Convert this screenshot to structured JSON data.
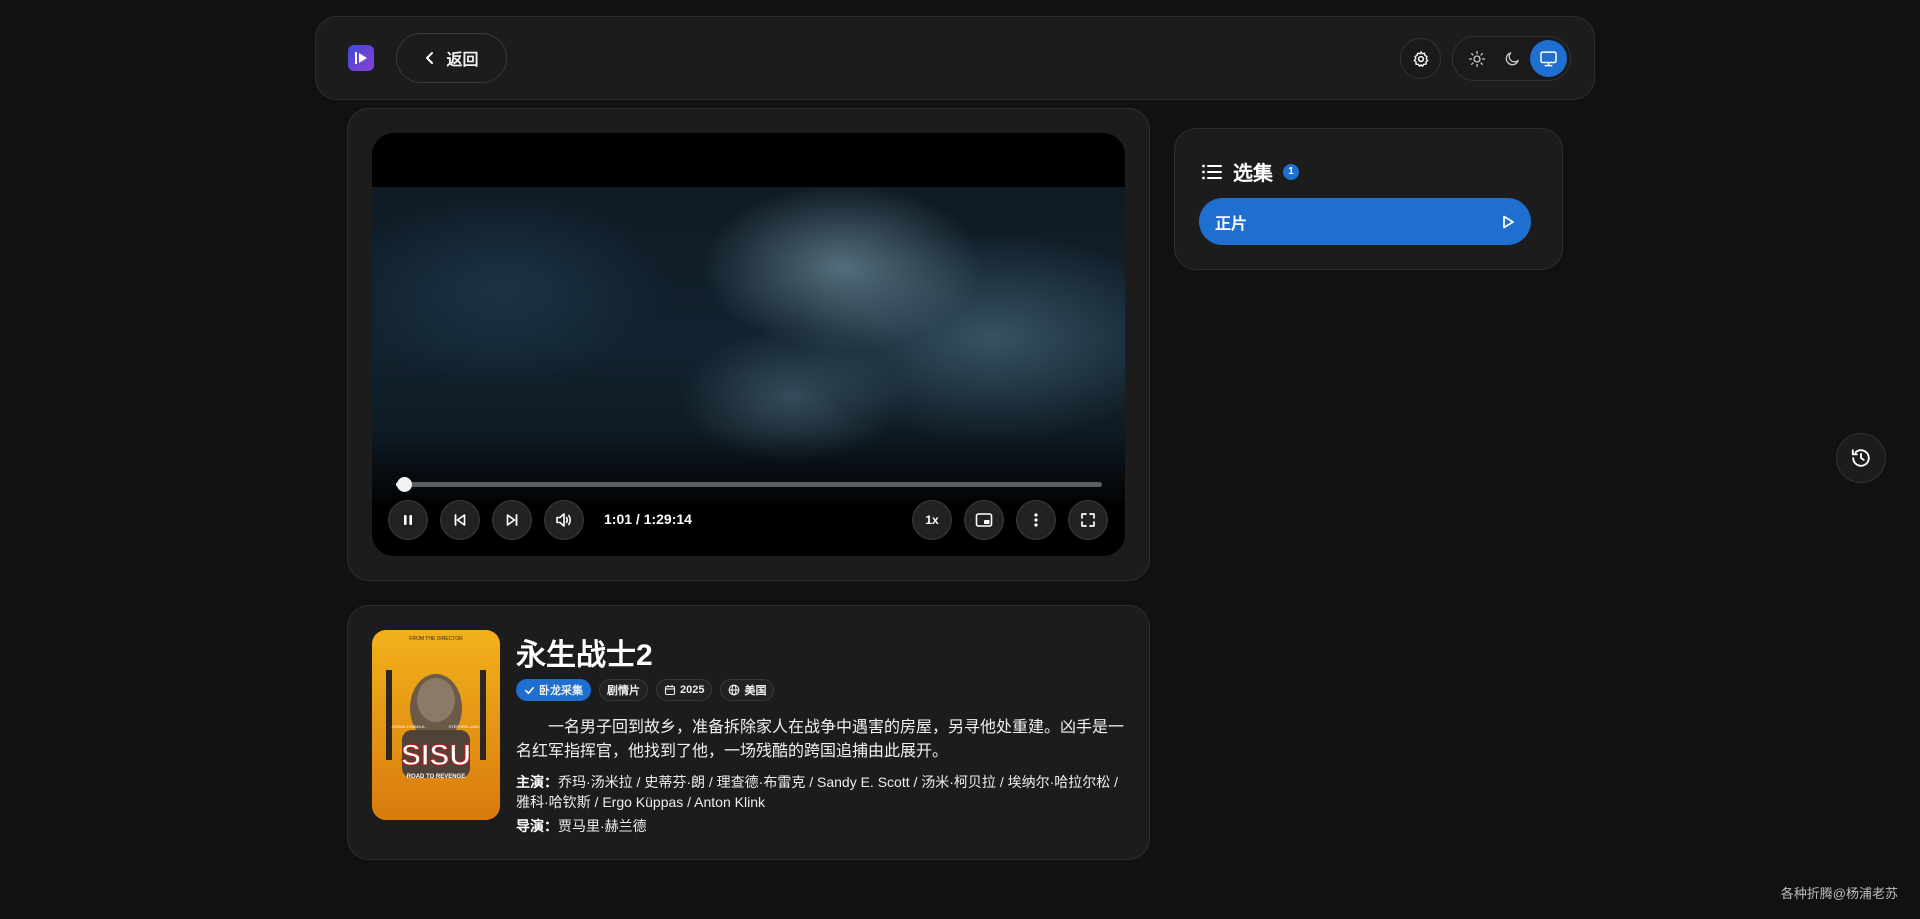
{
  "header": {
    "back_label": "返回"
  },
  "player": {
    "time_display": "1:01 / 1:29:14",
    "speed_label": "1x",
    "progress": 0.0114
  },
  "episodes": {
    "title": "选集",
    "count": "1",
    "items": [
      {
        "label": "正片"
      }
    ]
  },
  "movie": {
    "title": "永生战士2",
    "tags": {
      "source": "卧龙采集",
      "genre": "剧情片",
      "year": "2025",
      "region": "美国"
    },
    "synopsis": "一名男子回到故乡，准备拆除家人在战争中遇害的房屋，另寻他处重建。凶手是一名红军指挥官，他找到了他，一场残酷的跨国追捕由此展开。",
    "cast_label": "主演：",
    "cast": "乔玛·汤米拉 / 史蒂芬·朗 / 理查德·布雷克 / Sandy E. Scott / 汤米·柯贝拉 / 埃纳尔·哈拉尔松 / 雅科·哈钦斯 / Ergo Küppas / Anton Klink",
    "director_label": "导演：",
    "director": "贾马里·赫兰德",
    "poster": {
      "top_text": "FROM THE DIRECTOR",
      "left_name": "JORMA TOMMILA",
      "right_name": "STEPHEN LANG",
      "logo": "SISU",
      "subtitle": "ROAD TO REVENGE"
    }
  },
  "footer": {
    "credit": "各种折腾@杨浦老苏"
  },
  "colors": {
    "accent": "#1f6fd1",
    "background": "#111111",
    "card": "#1c1c1c"
  }
}
